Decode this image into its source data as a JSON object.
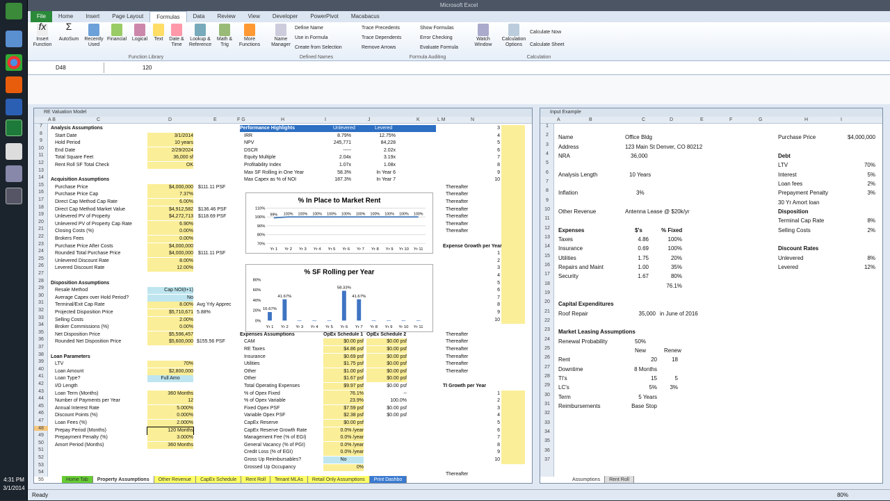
{
  "window_title": "Microsoft Excel",
  "clock": {
    "time": "4:31 PM",
    "date": "3/1/2014"
  },
  "ribbon_tabs": [
    "File",
    "Home",
    "Insert",
    "Page Layout",
    "Formulas",
    "Data",
    "Review",
    "View",
    "Developer",
    "PowerPivot",
    "Macabacus"
  ],
  "ribbon": {
    "insert_function": "Insert Function",
    "autosum": "AutoSum",
    "recent": "Recently Used",
    "financial": "Financial",
    "logical": "Logical",
    "text": "Text",
    "date_time": "Date & Time",
    "lookup": "Lookup & Reference",
    "math": "Math & Trig",
    "more": "More Functions",
    "function_library": "Function Library",
    "name_manager": "Name Manager",
    "define_name": "Define Name",
    "use_in_formula": "Use in Formula",
    "create_from_selection": "Create from Selection",
    "defined_names": "Defined Names",
    "trace_precedents": "Trace Precedents",
    "trace_dependents": "Trace Dependents",
    "remove_arrows": "Remove Arrows",
    "show_formulas": "Show Formulas",
    "error_checking": "Error Checking",
    "evaluate_formula": "Evaluate Formula",
    "formula_auditing": "Formula Auditing",
    "watch_window": "Watch Window",
    "calc_options": "Calculation Options",
    "calc_now": "Calculate Now",
    "calc_sheet": "Calculate Sheet",
    "calculation": "Calculation"
  },
  "namebox": "D48",
  "formula_value": "120",
  "left_window": {
    "title": "RE Valuation Model"
  },
  "right_window": {
    "title": "Input Example"
  },
  "left_rows": [
    "7",
    "8",
    "9",
    "10",
    "11",
    "12",
    "13",
    "14",
    "15",
    "16",
    "17",
    "18",
    "19",
    "20",
    "21",
    "22",
    "23",
    "24",
    "25",
    "26",
    "27",
    "28",
    "29",
    "30",
    "31",
    "32",
    "33",
    "34",
    "35",
    "36",
    "37",
    "38",
    "39",
    "40",
    "41",
    "42",
    "43",
    "44",
    "45",
    "46",
    "47",
    "48",
    "49",
    "50",
    "51",
    "52",
    "53",
    "54",
    "55"
  ],
  "analysis": [
    [
      "Analysis Assumptions",
      "",
      ""
    ],
    [
      "Start Date",
      "3/1/2014",
      ""
    ],
    [
      "Hold Period",
      "10 years",
      ""
    ],
    [
      "End Date",
      "2/29/2024",
      ""
    ],
    [
      "Total Square Feet",
      "36,000 sf",
      ""
    ],
    [
      "Rent Roll SF Total Check",
      "OK",
      ""
    ]
  ],
  "acq_title": "Acquisition Assumptions",
  "acq": [
    [
      "Purchase Price",
      "$4,000,000",
      "$111.11 PSF"
    ],
    [
      "Purchase Price Cap",
      "7.37%",
      ""
    ],
    [
      "Direct Cap Method Cap Rate",
      "6.00%",
      ""
    ],
    [
      "Direct Cap Method Market Value",
      "$4,912,582",
      "$136.46 PSF"
    ],
    [
      "Unlevered PV of Property",
      "$4,272,713",
      "$118.69 PSF"
    ],
    [
      "Unlevered PV of Property Cap Rate",
      "6.90%",
      ""
    ],
    [
      "Closing Costs (%)",
      "0.00%",
      ""
    ],
    [
      "Brokers Fees",
      "0.00%",
      ""
    ],
    [
      "Purchase Price After Costs",
      "$4,000,000",
      ""
    ],
    [
      "Rounded Total Purchase Price",
      "$4,000,000",
      "$111.11 PSF"
    ],
    [
      "Unlevered Discount Rate",
      "8.00%",
      ""
    ],
    [
      "Levered Discount Rate",
      "12.00%",
      ""
    ]
  ],
  "disp_title": "Disposition Assumptions",
  "disp": [
    [
      "Resale Method",
      "Cap NOI(t+1)",
      ""
    ],
    [
      "Average Capex over Hold Period?",
      "No",
      ""
    ],
    [
      "Terminal/Exit Cap Rate",
      "8.00%",
      "Avg Yrly Apprec"
    ],
    [
      "Projected Disposition Price",
      "$5,710,671",
      "5.88%"
    ],
    [
      "Selling Costs",
      "2.00%",
      ""
    ],
    [
      "Broker Commissions (%)",
      "0.00%",
      ""
    ],
    [
      "Net Disposition Price",
      "$5,596,457",
      ""
    ],
    [
      "Rounded Net Disposition Price",
      "$5,600,000",
      "$155.56 PSF"
    ]
  ],
  "loan_title": "Loan Parameters",
  "loan": [
    [
      "LTV",
      "70%"
    ],
    [
      "Loan Amount",
      "$2,800,000"
    ],
    [
      "Loan Type?",
      "Full Amo"
    ],
    [
      "I/O Length",
      ""
    ],
    [
      "Loan Term (Months)",
      "360 Months"
    ],
    [
      "Number of Payments per Year",
      "12"
    ],
    [
      "Annual Interest Rate",
      "5.000%"
    ],
    [
      "Discount Points (%)",
      "0.000%"
    ],
    [
      "Loan Fees (%)",
      "2.000%"
    ],
    [
      "Prepay Period (Months)",
      "120 Months"
    ],
    [
      "Prepayment Penalty (%)",
      "3.000%"
    ],
    [
      "Amort Period (Months)",
      "360 Months"
    ]
  ],
  "perf": {
    "title": "Performance Highlights",
    "h1": "Unlevered",
    "h2": "Levered",
    "rows": [
      [
        "IRR",
        "8.79%",
        "12.75%"
      ],
      [
        "NPV",
        "245,771",
        "84,228"
      ],
      [
        "DSCR",
        "-----",
        "2.02x"
      ],
      [
        "Equity Multiple",
        "2.04x",
        "3.19x"
      ],
      [
        "Profitability Index",
        "1.07x",
        "1.08x"
      ],
      [
        "Max SF Rolling in One Year",
        "58.3%",
        "In Year 6"
      ],
      [
        "Max Capex as % of NOI",
        "187.3%",
        "In Year 7"
      ]
    ]
  },
  "chart_data": [
    {
      "type": "line",
      "title": "% In Place to Market Rent",
      "categories": [
        "Yr 1",
        "Yr 2",
        "Yr 3",
        "Yr 4",
        "Yr 5",
        "Yr 6",
        "Yr 7",
        "Yr 8",
        "Yr 9",
        "Yr 10",
        "Yr 11"
      ],
      "values": [
        99,
        100,
        100,
        100,
        100,
        100,
        100,
        100,
        100,
        100,
        100
      ],
      "labels": [
        "99%",
        "100%",
        "100%",
        "100%",
        "100%",
        "100%",
        "100%",
        "100%",
        "100%",
        "100%",
        "100%"
      ],
      "ylim": [
        70,
        110
      ],
      "yticks": [
        "110%",
        "100%",
        "90%",
        "80%",
        "70%"
      ]
    },
    {
      "type": "bar",
      "title": "% SF Rolling per Year",
      "categories": [
        "Yr 1",
        "Yr 2",
        "Yr 3",
        "Yr 4",
        "Yr 5",
        "Yr 6",
        "Yr 7",
        "Yr 8",
        "Yr 9",
        "Yr 10",
        "Yr 11"
      ],
      "values": [
        16.67,
        41.67,
        0,
        0,
        0,
        58.33,
        41.67,
        0,
        0,
        0,
        0
      ],
      "labels": [
        "16.67%",
        "41.67%",
        "",
        "",
        "",
        "58.33%",
        "41.67%",
        "",
        "",
        "",
        ""
      ],
      "ylim": [
        0,
        80
      ],
      "yticks": [
        "80%",
        "60%",
        "40%",
        "20%",
        "0%"
      ]
    }
  ],
  "exp": {
    "title": "Expenses Assumptions",
    "h1": "OpEx Schedule 1",
    "h2": "OpEx Schedule 2",
    "rows": [
      [
        "CAM",
        "$0.00 psf",
        "$0.00 psf"
      ],
      [
        "RE Taxes",
        "$4.86 psf",
        "$0.00 psf"
      ],
      [
        "Insurance",
        "$0.69 psf",
        "$0.00 psf"
      ],
      [
        "Utilities",
        "$1.75 psf",
        "$0.00 psf"
      ],
      [
        "Other",
        "$1.00 psf",
        "$0.00 psf"
      ],
      [
        "Other",
        "$1.67 psf",
        "$0.00 psf"
      ],
      [
        "Total Operating Expenses",
        "$9.97 psf",
        "$0.00 psf"
      ],
      [
        "% of Opex Fixed",
        "76.1%",
        "--"
      ],
      [
        "% of Opex Variable",
        "23.9%",
        "100.0%"
      ],
      [
        "Fixed Opex PSF",
        "$7.59 psf",
        "$0.00 psf"
      ],
      [
        "Variable Opex PSF",
        "$2.38 psf",
        "$0.00 psf"
      ],
      [
        "CapEx Reserve",
        "$0.00 psf",
        ""
      ],
      [
        "CapEx Reserve Growth Rate",
        "0.0% /year",
        ""
      ],
      [
        "Management Fee (% of EGI)",
        "0.0% /year",
        ""
      ],
      [
        "General Vacancy (% of PGI)",
        "0.0% /year",
        ""
      ],
      [
        "Credit Loss (% of EGI)",
        "0.0% /year",
        ""
      ],
      [
        "Gross Up Reimbursables?",
        "No",
        ""
      ],
      [
        "Grossed Up Occupancy",
        "0%",
        ""
      ]
    ]
  },
  "side_top": [
    "3",
    "4",
    "5",
    "6",
    "7",
    "8",
    "9",
    "10"
  ],
  "thereafter": "Thereafter",
  "exp_growth": "Expense Growth per Year",
  "ti_growth": "TI Growth per Year",
  "seq": [
    "1",
    "2",
    "3",
    "4",
    "5",
    "6",
    "7",
    "8",
    "9",
    "10"
  ],
  "left_sheet_tabs": [
    "Home Tab",
    "Property Assumptions",
    "Other Revenue",
    "CapEx Schedule",
    "Rent Roll",
    "Tenant MLAs",
    "Retail Only Assumptions",
    "Print Dashbo"
  ],
  "right_cols": [
    "A",
    "B",
    "C",
    "D",
    "E",
    "F",
    "G",
    "H",
    "I"
  ],
  "right_rows": [
    "1",
    "2",
    "3",
    "4",
    "5",
    "6",
    "7",
    "8",
    "9",
    "10",
    "11",
    "12",
    "13",
    "14",
    "15",
    "16",
    "17",
    "18",
    "19",
    "20",
    "21",
    "22",
    "23",
    "24",
    "25",
    "26",
    "27",
    "28",
    "29",
    "30",
    "31",
    "32",
    "33",
    "34",
    "35",
    "36",
    "37"
  ],
  "input": {
    "name": [
      "Name",
      "Office Bldg"
    ],
    "address": [
      "Address",
      "123 Main St Denver, CO 80212"
    ],
    "nra": [
      "NRA",
      "36,000"
    ],
    "analysis": [
      "Analysis Length",
      "10 Years"
    ],
    "inflation": [
      "Inflation",
      "3%"
    ],
    "other_rev": [
      "Other Revenue",
      "Antenna Lease @ $20k/yr"
    ],
    "exp_hdr": [
      "Expenses",
      "$'s",
      "% Fixed"
    ],
    "exp_rows": [
      [
        "Taxes",
        "4.86",
        "100%"
      ],
      [
        "Insurance",
        "0.69",
        "100%"
      ],
      [
        "Utilities",
        "1.75",
        "20%"
      ],
      [
        "Repairs and Maint",
        "1.00",
        "35%"
      ],
      [
        "Security",
        "1.67",
        "80%"
      ],
      [
        "",
        "",
        "76.1%"
      ]
    ],
    "capex_title": "Capital Expenditures",
    "roof": [
      "Roof Repair",
      "35,000",
      "in June of 2016"
    ],
    "leasing_title": "Market Leasing Assumptions",
    "renewal": [
      "Renewal Probability",
      "50%"
    ],
    "new": "New",
    "renew": "Renew",
    "leasing_rows": [
      [
        "Rent",
        "20",
        "18"
      ],
      [
        "Downtime",
        "8 Months",
        ""
      ],
      [
        "TI's",
        "15",
        "5"
      ],
      [
        "LC's",
        "5%",
        "3%"
      ],
      [
        "Term",
        "5 Years",
        ""
      ],
      [
        "Reimbursements",
        "Base Stop",
        ""
      ]
    ],
    "purchase": [
      "Purchase Price",
      "$4,000,000"
    ],
    "debt": "Debt",
    "debt_rows": [
      [
        "LTV",
        "70%"
      ],
      [
        "Interest",
        "5%"
      ],
      [
        "Loan fees",
        "2%"
      ],
      [
        "Prepayment Penalty",
        "3%"
      ],
      [
        "30 Yr Amort loan",
        ""
      ]
    ],
    "disp": "Disposition",
    "disp_rows": [
      [
        "Terminal Cap Rate",
        "8%"
      ],
      [
        "Selling Costs",
        "2%"
      ]
    ],
    "disc": "Discount Rates",
    "disc_rows": [
      [
        "Unlevered",
        "8%"
      ],
      [
        "Levered",
        "12%"
      ]
    ]
  },
  "right_sheet_tabs": [
    "Assumptions",
    "Rent Roll"
  ],
  "status": "Ready",
  "zoom": "80%"
}
